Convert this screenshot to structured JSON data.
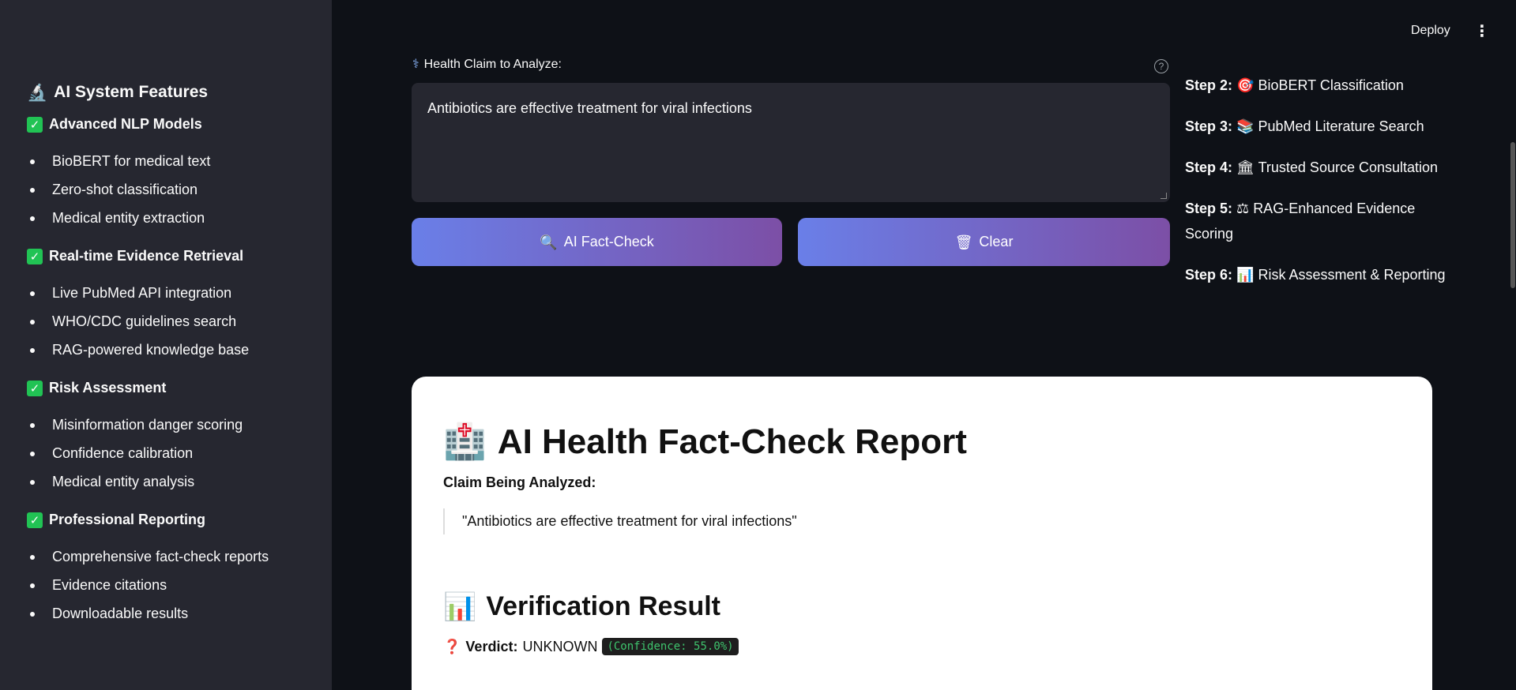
{
  "sidebar": {
    "title": "AI System Features",
    "sections": [
      {
        "title": "Advanced NLP Models",
        "items": [
          "BioBERT for medical text",
          "Zero-shot classification",
          "Medical entity extraction"
        ]
      },
      {
        "title": "Real-time Evidence Retrieval",
        "items": [
          "Live PubMed API integration",
          "WHO/CDC guidelines search",
          "RAG-powered knowledge base"
        ]
      },
      {
        "title": "Risk Assessment",
        "items": [
          "Misinformation danger scoring",
          "Confidence calibration",
          "Medical entity analysis"
        ]
      },
      {
        "title": "Professional Reporting",
        "items": [
          "Comprehensive fact-check reports",
          "Evidence citations",
          "Downloadable results"
        ]
      }
    ]
  },
  "header": {
    "deploy_label": "Deploy",
    "menu_icon": "⋮"
  },
  "input": {
    "label": "Health Claim to Analyze:",
    "value": "Antibiotics are effective treatment for viral infections",
    "help_icon": "?"
  },
  "buttons": {
    "fact_check": "AI Fact-Check",
    "clear": "Clear"
  },
  "steps": [
    {
      "num": "Step 2:",
      "icon": "🎯",
      "text": "BioBERT Classification"
    },
    {
      "num": "Step 3:",
      "icon": "📚",
      "text": "PubMed Literature Search"
    },
    {
      "num": "Step 4:",
      "icon": "🏛",
      "text": "Trusted Source Consultation"
    },
    {
      "num": "Step 5:",
      "icon": "⚖",
      "text": "RAG-Enhanced Evidence Scoring"
    },
    {
      "num": "Step 6:",
      "icon": "📊",
      "text": "Risk Assessment & Reporting"
    }
  ],
  "report": {
    "title": "AI Health Fact-Check Report",
    "claim_label": "Claim Being Analyzed:",
    "claim_quote": "\"Antibiotics are effective treatment for viral infections\"",
    "section_title": "Verification Result",
    "verdict_label": "Verdict:",
    "verdict_value": "UNKNOWN",
    "confidence": "(Confidence: 55.0%)"
  }
}
